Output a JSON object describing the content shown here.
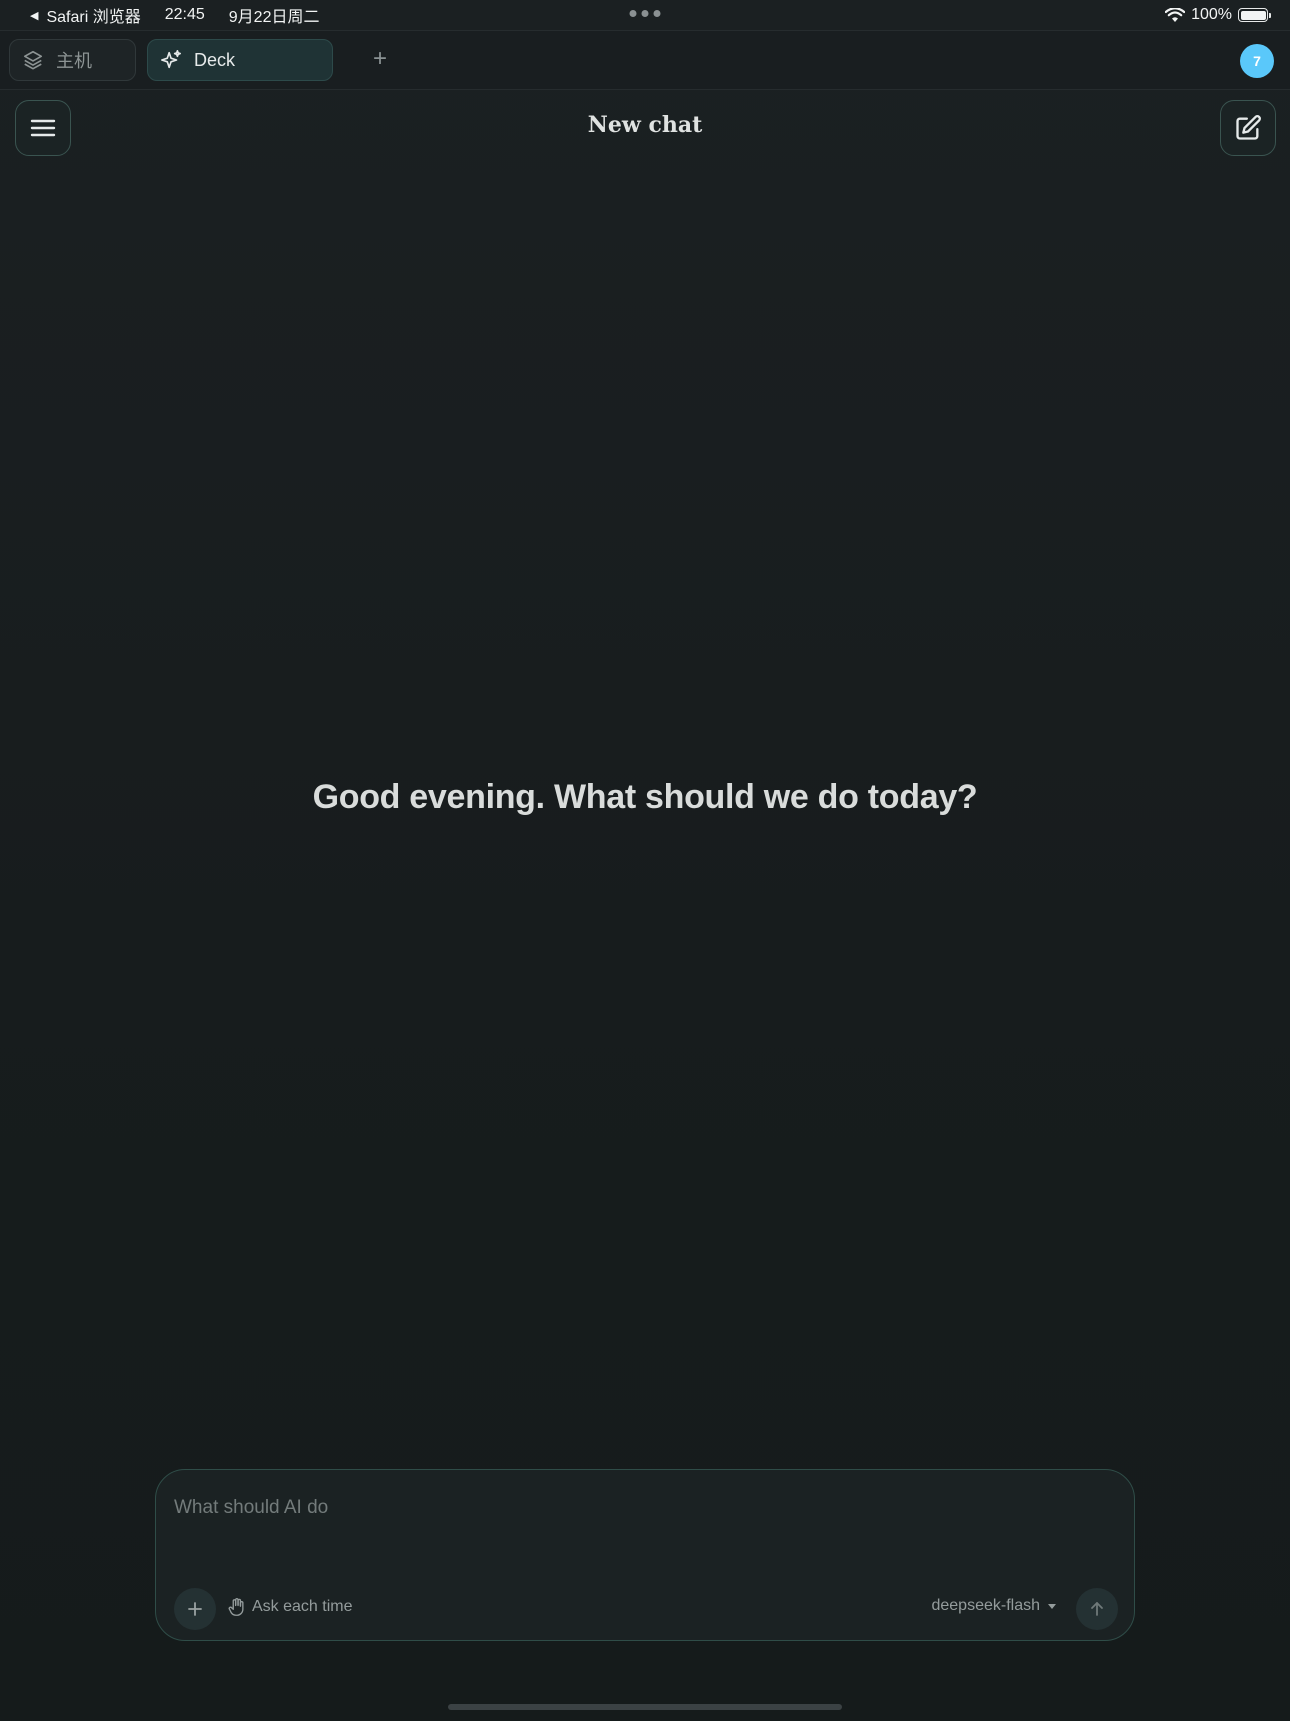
{
  "status_bar": {
    "back_app": "Safari 浏览器",
    "time": "22:45",
    "date": "9月22日周二",
    "battery": "100%",
    "battery_level": 1.0
  },
  "tabs": [
    {
      "label": "主机",
      "icon": "layers-icon",
      "active": false
    },
    {
      "label": "Deck",
      "icon": "sparkle-icon",
      "active": true
    }
  ],
  "avatar": {
    "badge": "7",
    "color": "#5ac8fa"
  },
  "header": {
    "title": "New chat"
  },
  "main": {
    "greeting": "Good evening. What should we do today?"
  },
  "composer": {
    "placeholder": "What should AI do",
    "value": "",
    "permission_label": "Ask each time",
    "model": "deepseek-flash"
  },
  "colors": {
    "background": "#181d1f",
    "accent_border": "#2f4d48",
    "active_tab": "#1f3335",
    "avatar": "#5ac8fa"
  }
}
